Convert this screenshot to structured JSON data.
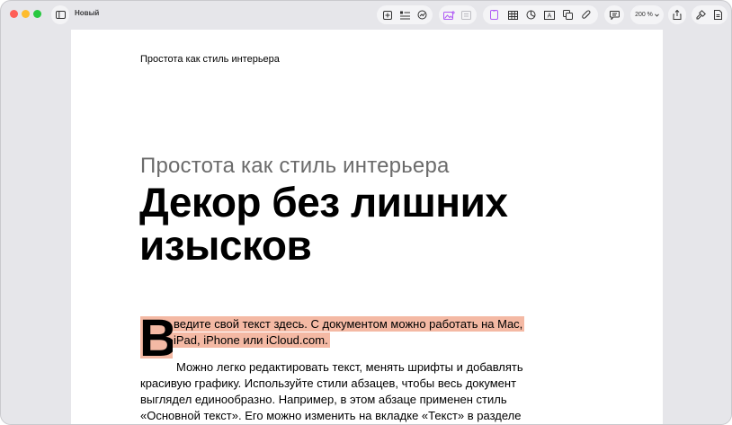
{
  "window": {
    "document_name": "Новый"
  },
  "toolbar": {
    "zoom_value": "200 %",
    "icons": [
      "sidebar-icon",
      "insert-icon",
      "list-icon",
      "chart-icon",
      "media-icon",
      "comment-icon",
      "page-icon",
      "table-icon",
      "pie-chart-icon",
      "text-box-icon",
      "shape-icon",
      "attachment-icon",
      "note-icon",
      "share-icon",
      "format-icon",
      "document-icon"
    ]
  },
  "document": {
    "header": "Простота как стиль интерьера",
    "subtitle": "Простота как стиль интерьера",
    "title": "Декор без лишних изысков",
    "dropcap": "В",
    "highlight_line1": "ведите свой текст здесь. С документом можно работать на Mac,",
    "highlight_line2": "iPad, iPhone или iCloud.com.",
    "body_paragraph": "Можно легко редактировать текст, менять шрифты и добавлять красивую графику. Используйте стили абзацев, чтобы весь документ выглядел единообразно. Например, в этом абзаце применен стиль «Основной текст». Его можно изменить на вкладке «Текст» в разделе настроек «Формат»."
  },
  "colors": {
    "highlight": "#f4b9a4",
    "window_bg": "#e6e6ea",
    "accent_purple": "#b05cf5"
  }
}
